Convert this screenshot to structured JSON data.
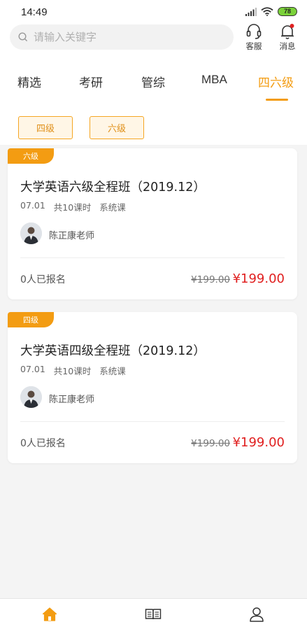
{
  "status_bar": {
    "time": "14:49",
    "battery": "78"
  },
  "search": {
    "placeholder": "请输入关键字"
  },
  "header": {
    "service_label": "客服",
    "message_label": "消息"
  },
  "tabs": [
    {
      "label": "精选",
      "active": false
    },
    {
      "label": "考研",
      "active": false
    },
    {
      "label": "管综",
      "active": false
    },
    {
      "label": "MBA",
      "active": false
    },
    {
      "label": "四六级",
      "active": true
    }
  ],
  "filters": [
    "四级",
    "六级"
  ],
  "courses": [
    {
      "tag": "六级",
      "title": "大学英语六级全程班（2019.12）",
      "date": "07.01",
      "lessons": "共10课时",
      "type": "系统课",
      "teacher": "陈正康老师",
      "enrolled": "0人已报名",
      "original_price": "¥199.00",
      "price": "¥199.00"
    },
    {
      "tag": "四级",
      "title": "大学英语四级全程班（2019.12）",
      "date": "07.01",
      "lessons": "共10课时",
      "type": "系统课",
      "teacher": "陈正康老师",
      "enrolled": "0人已报名",
      "original_price": "¥199.00",
      "price": "¥199.00"
    }
  ],
  "bottom_nav": [
    {
      "icon": "home-icon",
      "active": true
    },
    {
      "icon": "book-icon",
      "active": false
    },
    {
      "icon": "user-icon",
      "active": false
    }
  ],
  "colors": {
    "accent": "#f39c12",
    "price": "#e02020"
  }
}
